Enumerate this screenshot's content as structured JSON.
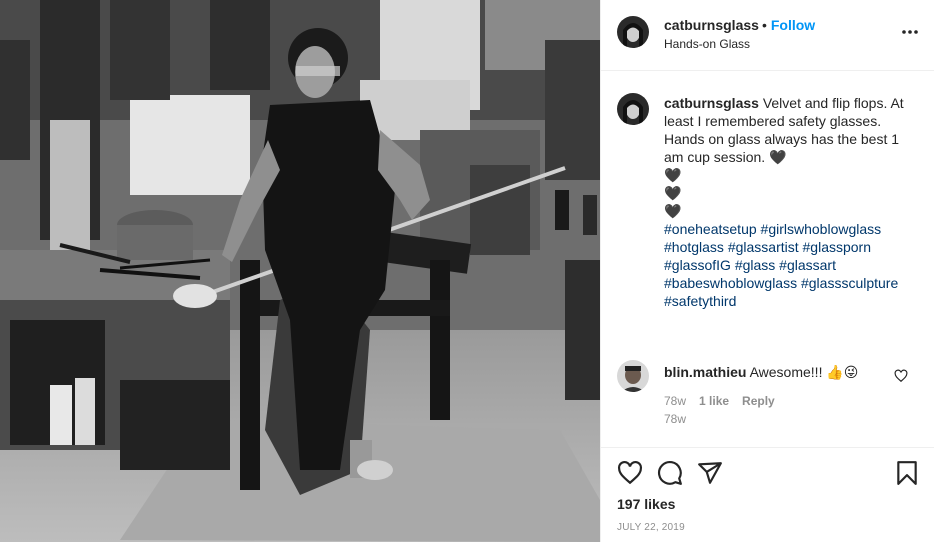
{
  "post": {
    "username": "catburnsglass",
    "dot": "•",
    "follow_label": "Follow",
    "location": "Hands-on Glass"
  },
  "caption": {
    "username": "catburnsglass",
    "text": "Velvet and flip flops. At least I remembered safety glasses. Hands on glass always has the best 1 am cup session.",
    "emoji_hearts": [
      "🖤",
      "🖤",
      "🖤",
      "🖤"
    ],
    "hashtags": "#oneheatsetup #girlswhoblowglass #hotglass #glassartist #glassporn #glassofIG #glass #glassart #babeswhoblowglass #glasssculpture #safetythird",
    "time": "78w"
  },
  "comment": {
    "username": "blin.mathieu",
    "text": "Awesome!!! 👍😜",
    "time": "78w",
    "likes": "1 like",
    "reply": "Reply"
  },
  "footer": {
    "likes": "197 likes",
    "date": "JULY 22, 2019"
  },
  "icons": {
    "more": "more-options-icon",
    "heart": "heart-icon",
    "comment": "comment-icon",
    "share": "share-icon",
    "save": "bookmark-icon"
  },
  "colors": {
    "link": "#0095f6",
    "hashtag": "#00376b",
    "muted": "#8e8e8e",
    "text": "#262626"
  }
}
